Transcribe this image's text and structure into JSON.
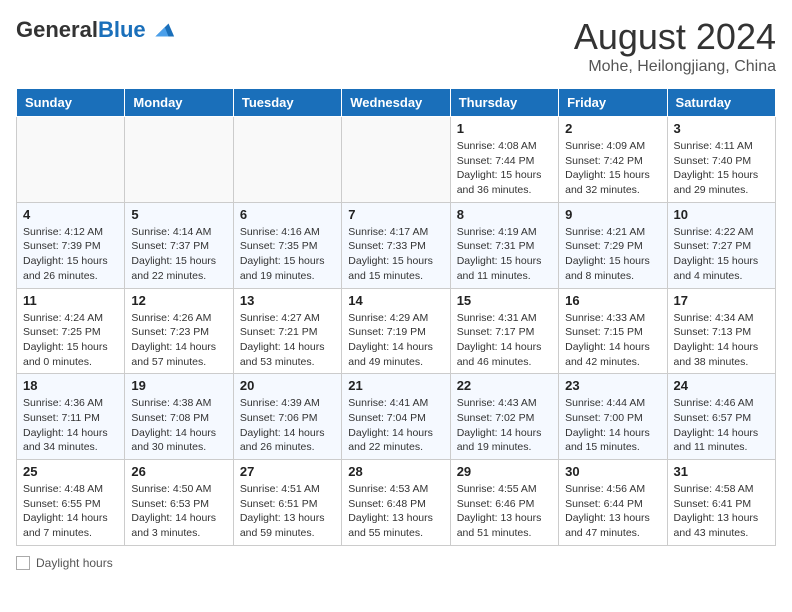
{
  "header": {
    "logo_general": "General",
    "logo_blue": "Blue",
    "month_year": "August 2024",
    "location": "Mohe, Heilongjiang, China"
  },
  "footer": {
    "label": "Daylight hours"
  },
  "columns": [
    "Sunday",
    "Monday",
    "Tuesday",
    "Wednesday",
    "Thursday",
    "Friday",
    "Saturday"
  ],
  "weeks": [
    [
      {
        "day": "",
        "info": ""
      },
      {
        "day": "",
        "info": ""
      },
      {
        "day": "",
        "info": ""
      },
      {
        "day": "",
        "info": ""
      },
      {
        "day": "1",
        "info": "Sunrise: 4:08 AM\nSunset: 7:44 PM\nDaylight: 15 hours\nand 36 minutes."
      },
      {
        "day": "2",
        "info": "Sunrise: 4:09 AM\nSunset: 7:42 PM\nDaylight: 15 hours\nand 32 minutes."
      },
      {
        "day": "3",
        "info": "Sunrise: 4:11 AM\nSunset: 7:40 PM\nDaylight: 15 hours\nand 29 minutes."
      }
    ],
    [
      {
        "day": "4",
        "info": "Sunrise: 4:12 AM\nSunset: 7:39 PM\nDaylight: 15 hours\nand 26 minutes."
      },
      {
        "day": "5",
        "info": "Sunrise: 4:14 AM\nSunset: 7:37 PM\nDaylight: 15 hours\nand 22 minutes."
      },
      {
        "day": "6",
        "info": "Sunrise: 4:16 AM\nSunset: 7:35 PM\nDaylight: 15 hours\nand 19 minutes."
      },
      {
        "day": "7",
        "info": "Sunrise: 4:17 AM\nSunset: 7:33 PM\nDaylight: 15 hours\nand 15 minutes."
      },
      {
        "day": "8",
        "info": "Sunrise: 4:19 AM\nSunset: 7:31 PM\nDaylight: 15 hours\nand 11 minutes."
      },
      {
        "day": "9",
        "info": "Sunrise: 4:21 AM\nSunset: 7:29 PM\nDaylight: 15 hours\nand 8 minutes."
      },
      {
        "day": "10",
        "info": "Sunrise: 4:22 AM\nSunset: 7:27 PM\nDaylight: 15 hours\nand 4 minutes."
      }
    ],
    [
      {
        "day": "11",
        "info": "Sunrise: 4:24 AM\nSunset: 7:25 PM\nDaylight: 15 hours\nand 0 minutes."
      },
      {
        "day": "12",
        "info": "Sunrise: 4:26 AM\nSunset: 7:23 PM\nDaylight: 14 hours\nand 57 minutes."
      },
      {
        "day": "13",
        "info": "Sunrise: 4:27 AM\nSunset: 7:21 PM\nDaylight: 14 hours\nand 53 minutes."
      },
      {
        "day": "14",
        "info": "Sunrise: 4:29 AM\nSunset: 7:19 PM\nDaylight: 14 hours\nand 49 minutes."
      },
      {
        "day": "15",
        "info": "Sunrise: 4:31 AM\nSunset: 7:17 PM\nDaylight: 14 hours\nand 46 minutes."
      },
      {
        "day": "16",
        "info": "Sunrise: 4:33 AM\nSunset: 7:15 PM\nDaylight: 14 hours\nand 42 minutes."
      },
      {
        "day": "17",
        "info": "Sunrise: 4:34 AM\nSunset: 7:13 PM\nDaylight: 14 hours\nand 38 minutes."
      }
    ],
    [
      {
        "day": "18",
        "info": "Sunrise: 4:36 AM\nSunset: 7:11 PM\nDaylight: 14 hours\nand 34 minutes."
      },
      {
        "day": "19",
        "info": "Sunrise: 4:38 AM\nSunset: 7:08 PM\nDaylight: 14 hours\nand 30 minutes."
      },
      {
        "day": "20",
        "info": "Sunrise: 4:39 AM\nSunset: 7:06 PM\nDaylight: 14 hours\nand 26 minutes."
      },
      {
        "day": "21",
        "info": "Sunrise: 4:41 AM\nSunset: 7:04 PM\nDaylight: 14 hours\nand 22 minutes."
      },
      {
        "day": "22",
        "info": "Sunrise: 4:43 AM\nSunset: 7:02 PM\nDaylight: 14 hours\nand 19 minutes."
      },
      {
        "day": "23",
        "info": "Sunrise: 4:44 AM\nSunset: 7:00 PM\nDaylight: 14 hours\nand 15 minutes."
      },
      {
        "day": "24",
        "info": "Sunrise: 4:46 AM\nSunset: 6:57 PM\nDaylight: 14 hours\nand 11 minutes."
      }
    ],
    [
      {
        "day": "25",
        "info": "Sunrise: 4:48 AM\nSunset: 6:55 PM\nDaylight: 14 hours\nand 7 minutes."
      },
      {
        "day": "26",
        "info": "Sunrise: 4:50 AM\nSunset: 6:53 PM\nDaylight: 14 hours\nand 3 minutes."
      },
      {
        "day": "27",
        "info": "Sunrise: 4:51 AM\nSunset: 6:51 PM\nDaylight: 13 hours\nand 59 minutes."
      },
      {
        "day": "28",
        "info": "Sunrise: 4:53 AM\nSunset: 6:48 PM\nDaylight: 13 hours\nand 55 minutes."
      },
      {
        "day": "29",
        "info": "Sunrise: 4:55 AM\nSunset: 6:46 PM\nDaylight: 13 hours\nand 51 minutes."
      },
      {
        "day": "30",
        "info": "Sunrise: 4:56 AM\nSunset: 6:44 PM\nDaylight: 13 hours\nand 47 minutes."
      },
      {
        "day": "31",
        "info": "Sunrise: 4:58 AM\nSunset: 6:41 PM\nDaylight: 13 hours\nand 43 minutes."
      }
    ]
  ]
}
